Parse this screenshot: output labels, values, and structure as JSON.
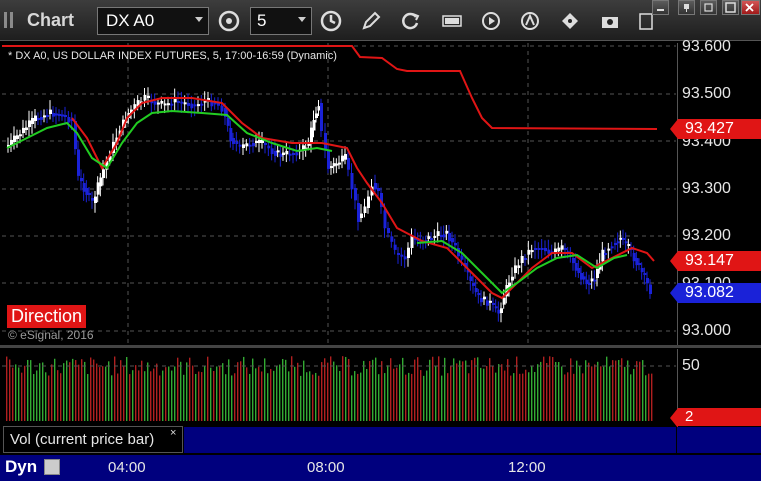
{
  "toolbar": {
    "app_title": "Chart",
    "symbol": "DX A0",
    "interval": "5"
  },
  "chart": {
    "header": "* DX A0, US DOLLAR INDEX FUTURES, 5, 17:00-16:59 (Dynamic)",
    "direction_label": "Direction",
    "copyright": "© eSignal, 2016",
    "price_labels": [
      "93.600",
      "93.500",
      "93.400",
      "93.300",
      "93.200",
      "93.100",
      "93.000"
    ],
    "price_tags": {
      "red_upper": "93.427",
      "red_lower": "93.147",
      "blue_last": "93.082"
    },
    "colors": {
      "up_bar": "#ffffff",
      "down_bar": "#1a22d8",
      "red_line": "#e01515",
      "green_line": "#22cc22"
    }
  },
  "volume": {
    "legend": "Vol (current price bar)",
    "close_glyph": "×",
    "scale_top": "50",
    "last_value": "2"
  },
  "time_axis": {
    "mode_label": "Dyn",
    "ticks": [
      "04:00",
      "08:00",
      "12:00"
    ]
  }
}
